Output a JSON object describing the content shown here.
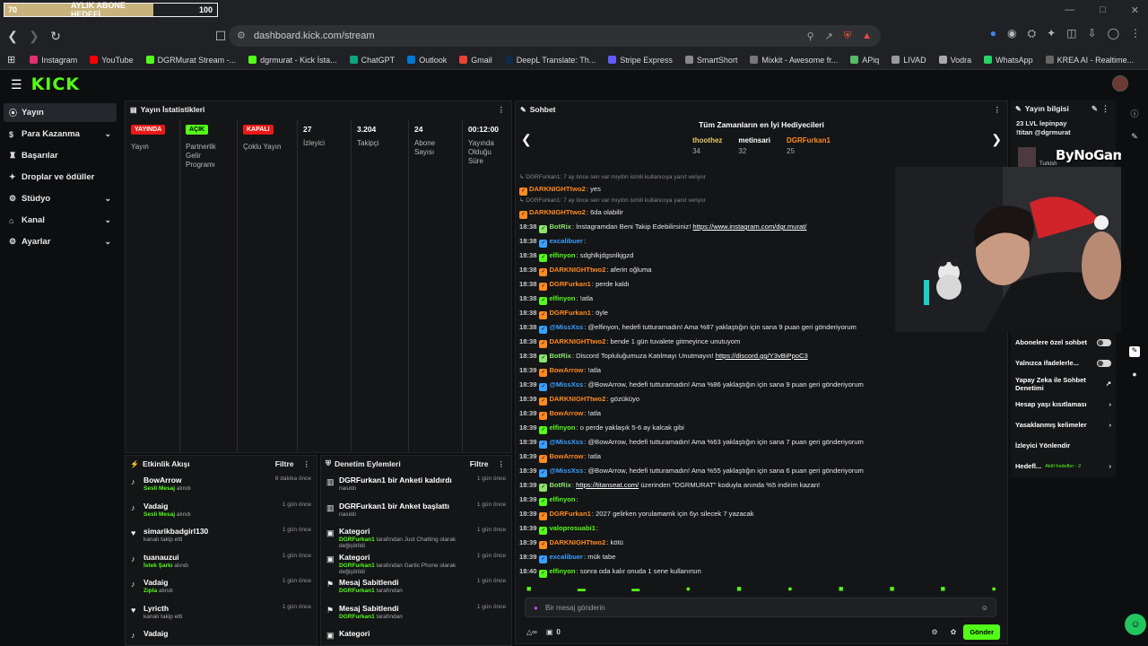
{
  "goal": {
    "current": "70",
    "label": "AYLIK ABONE HEDEFİ",
    "max": "100",
    "progress": 0.7
  },
  "browser": {
    "url": "dashboard.kick.com/stream",
    "bookmarks": [
      "Instagram",
      "YouTube",
      "DGRMurat Stream -...",
      "dgrmurat - Kick İsta...",
      "ChatGPT",
      "Outlook",
      "Gmail",
      "DeepL Translate: Th...",
      "Stripe Express",
      "SmartShort",
      "Mixkit - Awesome fr...",
      "APiq",
      "LIVAD",
      "Vodra",
      "WhatsApp",
      "KREA AI - Realtime..."
    ]
  },
  "app": {
    "logo": "KICK"
  },
  "sidebar": {
    "items": [
      {
        "label": "Yayın",
        "chevron": false
      },
      {
        "label": "Para Kazanma",
        "chevron": true
      },
      {
        "label": "Başarılar",
        "chevron": false
      },
      {
        "label": "Droplar ve ödüller",
        "chevron": false
      },
      {
        "label": "Stüdyo",
        "chevron": true
      },
      {
        "label": "Kanal",
        "chevron": true
      },
      {
        "label": "Ayarlar",
        "chevron": true
      }
    ]
  },
  "stats": {
    "title": "Yayın İstatistikleri",
    "cols": [
      {
        "badge": "YAYINDA",
        "label": "Yayın"
      },
      {
        "badge": "AÇIK",
        "label": "Partnerlik Gelir Programı"
      },
      {
        "badge": "KAPALI",
        "label": "Çoklu Yayın"
      },
      {
        "value": "27",
        "label": "İzleyici"
      },
      {
        "value": "3.204",
        "label": "Takipçi"
      },
      {
        "value": "24",
        "label": "Abone Sayısı"
      },
      {
        "value": "00:12:00",
        "label": "Yayında Olduğu Süre"
      }
    ]
  },
  "activity": {
    "title": "Etkinlik Akışı",
    "filter": "Filtre",
    "items": [
      {
        "name": "BowArrow",
        "sub": "Sesli Mesaj",
        "sub2": " alındı",
        "time": "8 dakika önce"
      },
      {
        "name": "Vadaig",
        "sub": "Sesli Mesaj",
        "sub2": " alındı",
        "time": "1 gün önce"
      },
      {
        "name": "simarikbadgirl130",
        "sub": "",
        "sub2": "kanalı takip etti",
        "time": "1 gün önce"
      },
      {
        "name": "tuanauzui",
        "sub": "İstek Şarkı",
        "sub2": " alındı",
        "time": "1 gün önce"
      },
      {
        "name": "Vadaig",
        "sub": "Zıpla",
        "sub2": " alındı",
        "time": "1 gün önce"
      },
      {
        "name": "Lyricth",
        "sub": "",
        "sub2": "kanalı takip etti",
        "time": "1 gün önce"
      },
      {
        "name": "Vadaig",
        "sub": "",
        "sub2": "",
        "time": ""
      }
    ]
  },
  "moderation": {
    "title": "Denetim Eylemleri",
    "filter": "Filtre",
    "items": [
      {
        "name": "DGRFurkan1 bir Anketi kaldırdı",
        "sub": "",
        "sub2": "nasıldı",
        "time": "1 gün önce"
      },
      {
        "name": "DGRFurkan1 bir Anket başlattı",
        "sub": "",
        "sub2": "nasıldı",
        "time": "1 gün önce"
      },
      {
        "name": "Kategori",
        "sub": "DGRFurkan1",
        "sub2": " tarafından Just Chatting olarak değiştirildi",
        "time": "1 gün önce"
      },
      {
        "name": "Kategori",
        "sub": "DGRFurkan1",
        "sub2": " tarafından Gartic Phone olarak değiştirildi",
        "time": "1 gün önce"
      },
      {
        "name": "Mesaj Sabitlendi",
        "sub": "DGRFurkan1",
        "sub2": " tarafından",
        "time": "1 gün önce"
      },
      {
        "name": "Mesaj Sabitlendi",
        "sub": "DGRFurkan1",
        "sub2": " tarafından",
        "time": "1 gün önce"
      },
      {
        "name": "Kategori",
        "sub": "",
        "sub2": "",
        "time": ""
      }
    ]
  },
  "chat": {
    "title": "Sohbet",
    "gifters_title": "Tüm Zamanların en İyi Hediyecileri",
    "gifters": [
      {
        "name": "thoothez",
        "count": "34"
      },
      {
        "name": "metinsari",
        "count": "32"
      },
      {
        "name": "DGRFurkan1",
        "count": "25"
      }
    ],
    "messages": [
      {
        "reply": true,
        "text": "↳ DGRFurkan1: 7 ay önce sen var mıydın ismili kullanıcıya yanıt veriyor"
      },
      {
        "time": "",
        "user": "DARKNIGHTtwo2",
        "color": "#ff8a1f",
        "text": ": yes"
      },
      {
        "reply": true,
        "text": "↳ DGRFurkan1: 7 ay önce sen var mıydın ismili kullanıcıya yanıt veriyor"
      },
      {
        "time": "",
        "user": "DARKNIGHTtwo2",
        "color": "#ff8a1f",
        "text": ": 6da olabilir"
      },
      {
        "time": "18:38",
        "user": "BotRix",
        "color": "#8ce36a",
        "text": ": İnstagramdan Beni Takip Edebilirsiniz! ",
        "link": "https://www.instagram.com/dgr.murat/"
      },
      {
        "time": "18:38",
        "user": "excalibuer",
        "color": "#38a0ff",
        "text": ":"
      },
      {
        "time": "18:38",
        "user": "elfinyon",
        "color": "#53fc18",
        "text": ": sdghlkjdgsnlkjgzd"
      },
      {
        "time": "18:38",
        "user": "DARKNIGHTtwo2",
        "color": "#ff8a1f",
        "text": ": aferin oğluma"
      },
      {
        "time": "18:38",
        "user": "DGRFurkan1",
        "color": "#ff8a1f",
        "text": ": perde kaldı"
      },
      {
        "time": "18:38",
        "user": "elfinyon",
        "color": "#53fc18",
        "text": ": !atla"
      },
      {
        "time": "18:38",
        "user": "DGRFurkan1",
        "color": "#ff8a1f",
        "text": ": öyle"
      },
      {
        "time": "18:38",
        "user": "@MissXss",
        "color": "#38a0ff",
        "text": ": @elfinyon, hedefi tutturamadın! Ama %87 yaklaştığın için sana 9 puan geri gönderiyorum"
      },
      {
        "time": "18:38",
        "user": "DARKNIGHTtwo2",
        "color": "#ff8a1f",
        "text": ": bende 1 gün tuvalete gitmeyince unutuyom"
      },
      {
        "time": "18:38",
        "user": "BotRix",
        "color": "#8ce36a",
        "text": ": Discord Topluluğumuza Katılmayı Unutmayın! ",
        "link": "https://discord.gg/Y3vBiPpoC3"
      },
      {
        "time": "18:39",
        "user": "BowArrow",
        "color": "#ff8a1f",
        "text": ": !atla"
      },
      {
        "time": "18:39",
        "user": "@MissXss",
        "color": "#38a0ff",
        "text": ": @BowArrow, hedefi tutturamadın! Ama %86 yaklaştığın için sana 9 puan geri gönderiyorum"
      },
      {
        "time": "18:39",
        "user": "DARKNIGHTtwo2",
        "color": "#ff8a1f",
        "text": ": gözüküyo"
      },
      {
        "time": "18:39",
        "user": "BowArrow",
        "color": "#ff8a1f",
        "text": ": !atla"
      },
      {
        "time": "18:39",
        "user": "elfinyon",
        "color": "#53fc18",
        "text": ": o perde yaklaşık 5-6 ay kalcak gibi"
      },
      {
        "time": "18:39",
        "user": "@MissXss",
        "color": "#38a0ff",
        "text": ": @BowArrow, hedefi tutturamadın! Ama %63 yaklaştığın için sana 7 puan geri gönderiyorum"
      },
      {
        "time": "18:39",
        "user": "BowArrow",
        "color": "#ff8a1f",
        "text": ": !atla"
      },
      {
        "time": "18:39",
        "user": "@MissXss",
        "color": "#38a0ff",
        "text": ": @BowArrow, hedefi tutturamadın! Ama %55 yaklaştığın için sana 6 puan geri gönderiyorum"
      },
      {
        "time": "18:39",
        "user": "BotRix",
        "color": "#8ce36a",
        "text": ": ",
        "link": "https://titanseat.com/",
        "text2": " üzerinden \"DGRMURAT\" koduyla anında %5 indirim kazan!"
      },
      {
        "time": "18:39",
        "user": "elfinyon",
        "color": "#53fc18",
        "text": ":"
      },
      {
        "time": "18:39",
        "user": "DGRFurkan1",
        "color": "#ff8a1f",
        "text": ": 2027 gelirken yorulamamk için 6yı silecek 7 yazacak"
      },
      {
        "time": "18:39",
        "user": "valoprosuabi1",
        "color": "#53fc18",
        "text": ":"
      },
      {
        "time": "18:39",
        "user": "DARKNIGHTtwo2",
        "color": "#ff8a1f",
        "text": ": kötü"
      },
      {
        "time": "18:39",
        "user": "excalibuer",
        "color": "#38a0ff",
        "text": ": mük tabe"
      },
      {
        "time": "18:40",
        "user": "elfinyon",
        "color": "#53fc18",
        "text": ": sonra oda kalır onuda 1 sene kullanırsın"
      }
    ],
    "input_placeholder": "Bir mesaj gönderin",
    "points": "0",
    "send": "Gönder"
  },
  "info": {
    "title": "Yayın bilgisi",
    "stream_title": "23 LVL lepinpay !titan @dgrmurat",
    "tags": "Turkish",
    "watermark": "ByNoGame",
    "rows": [
      {
        "label": "Abonelere özel sohbet",
        "control": "toggle"
      },
      {
        "label": "Yalnızca ifadelerle...",
        "control": "toggle"
      },
      {
        "label": "Yapay Zeka ile Sohbet Denetimi",
        "control": "ext"
      },
      {
        "label": "Hesap yaşı kısıtlaması",
        "control": "chev"
      },
      {
        "label": "Yasaklanmış kelimeler",
        "control": "chev"
      },
      {
        "label": "İzleyici Yönlendir",
        "control": ""
      },
      {
        "label": "Hedefl...",
        "control": "chev",
        "extra": "Aktif hedefler - 2"
      }
    ]
  }
}
